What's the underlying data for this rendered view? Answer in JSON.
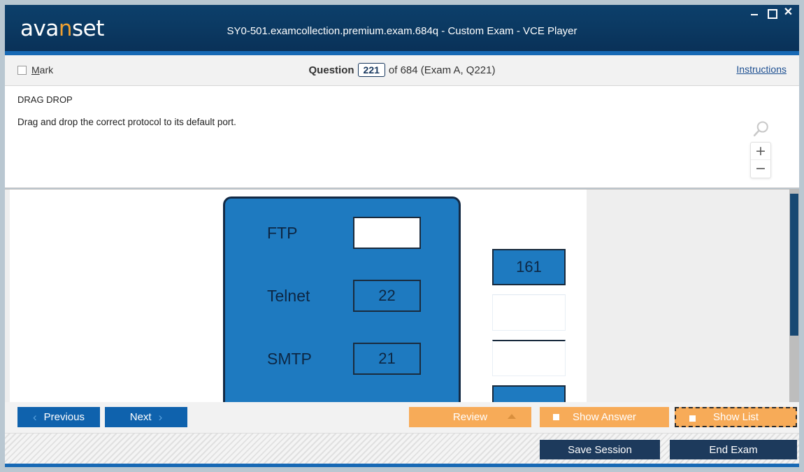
{
  "window": {
    "logo_text_part1": "ava",
    "logo_accent": "n",
    "logo_text_part2": "set",
    "title": "SY0-501.examcollection.premium.exam.684q - Custom Exam - VCE Player",
    "controls": {
      "minimize": "minimize-icon",
      "maximize": "maximize-icon",
      "close": "✕"
    }
  },
  "question_bar": {
    "mark_label_accel": "M",
    "mark_label_rest": "ark",
    "question_label": "Question",
    "question_number": "221",
    "of_text": "of 684 (Exam A, Q221)",
    "instructions_link": "Instructions"
  },
  "question_panel": {
    "type": "DRAG DROP",
    "prompt": "Drag and drop the correct protocol to its default port.",
    "zoom": {
      "magnifier": "magnifier-icon",
      "zoom_in": "+",
      "zoom_out": "−"
    }
  },
  "exhibit": {
    "rows": [
      {
        "label": "FTP",
        "value": "",
        "state": "empty"
      },
      {
        "label": "Telnet",
        "value": "22",
        "state": "filled"
      },
      {
        "label": "SMTP",
        "value": "21",
        "state": "filled"
      }
    ],
    "tray": [
      {
        "value": "161",
        "state": "filled"
      },
      {
        "value": "",
        "state": "blank"
      },
      {
        "value": "",
        "state": "blank"
      },
      {
        "value": "",
        "state": "filled"
      }
    ],
    "panel_color": "#1e7ac0",
    "border_color": "#132a45"
  },
  "nav": {
    "previous": "Previous",
    "next": "Next",
    "review": "Review",
    "show_answer": "Show Answer",
    "show_list": "Show List",
    "chevron_left": "‹",
    "chevron_right": "›"
  },
  "status": {
    "save_session": "Save Session",
    "end_exam": "End Exam"
  },
  "colors": {
    "title_bar": "#0b3a63",
    "accent_blue": "#1769b5",
    "button_blue": "#0f62ad",
    "orange": "#f7ab58",
    "dark_navy": "#1d3a5c",
    "logo_accent": "#f0a030"
  }
}
